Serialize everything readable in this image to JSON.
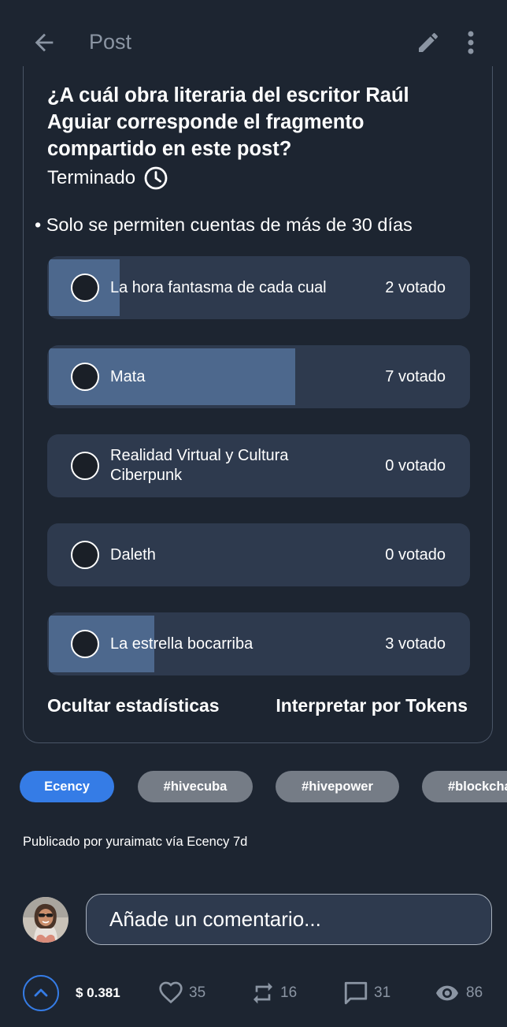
{
  "header": {
    "title": "Post",
    "back_icon": "arrow-left-icon",
    "edit_icon": "pencil-icon",
    "more_icon": "more-vertical-icon"
  },
  "poll": {
    "question": "¿A cuál obra literaria del escritor Raúl Aguiar corresponde el fragmento compartido en este post?",
    "status": "Terminado",
    "rule": "• Solo se permiten cuentas de más de 30 días",
    "choices": [
      {
        "label": "La hora fantasma de cada cual",
        "votes": "2 votado",
        "share": 0.1667
      },
      {
        "label": "Mata",
        "votes": "7 votado",
        "share": 0.5833
      },
      {
        "label": "Realidad Virtual y Cultura Ciberpunk",
        "votes": "0 votado",
        "share": 0
      },
      {
        "label": "Daleth",
        "votes": "0 votado",
        "share": 0
      },
      {
        "label": "La estrella bocarriba",
        "votes": "3 votado",
        "share": 0.25
      }
    ],
    "hide_stats_label": "Ocultar estadísticas",
    "interpret_label": "Interpretar por Tokens"
  },
  "tags": [
    "Ecency",
    "#hivecuba",
    "#hivepower",
    "#blockchain"
  ],
  "published": {
    "prefix": "Publicado por",
    "author": "yuraimatc",
    "via": "vía Ecency",
    "age": "7d"
  },
  "comment": {
    "placeholder": "Añade un comentario..."
  },
  "footer": {
    "payout": "$ 0.381",
    "likes": "35",
    "reblogs": "16",
    "comments": "31",
    "views": "86"
  },
  "colors": {
    "background": "#1d2531",
    "card": "#2e3a4e",
    "bar_fill": "#4d688d",
    "accent": "#357ce6",
    "muted_text": "#8b95a3",
    "tag_gray": "#757c86"
  }
}
